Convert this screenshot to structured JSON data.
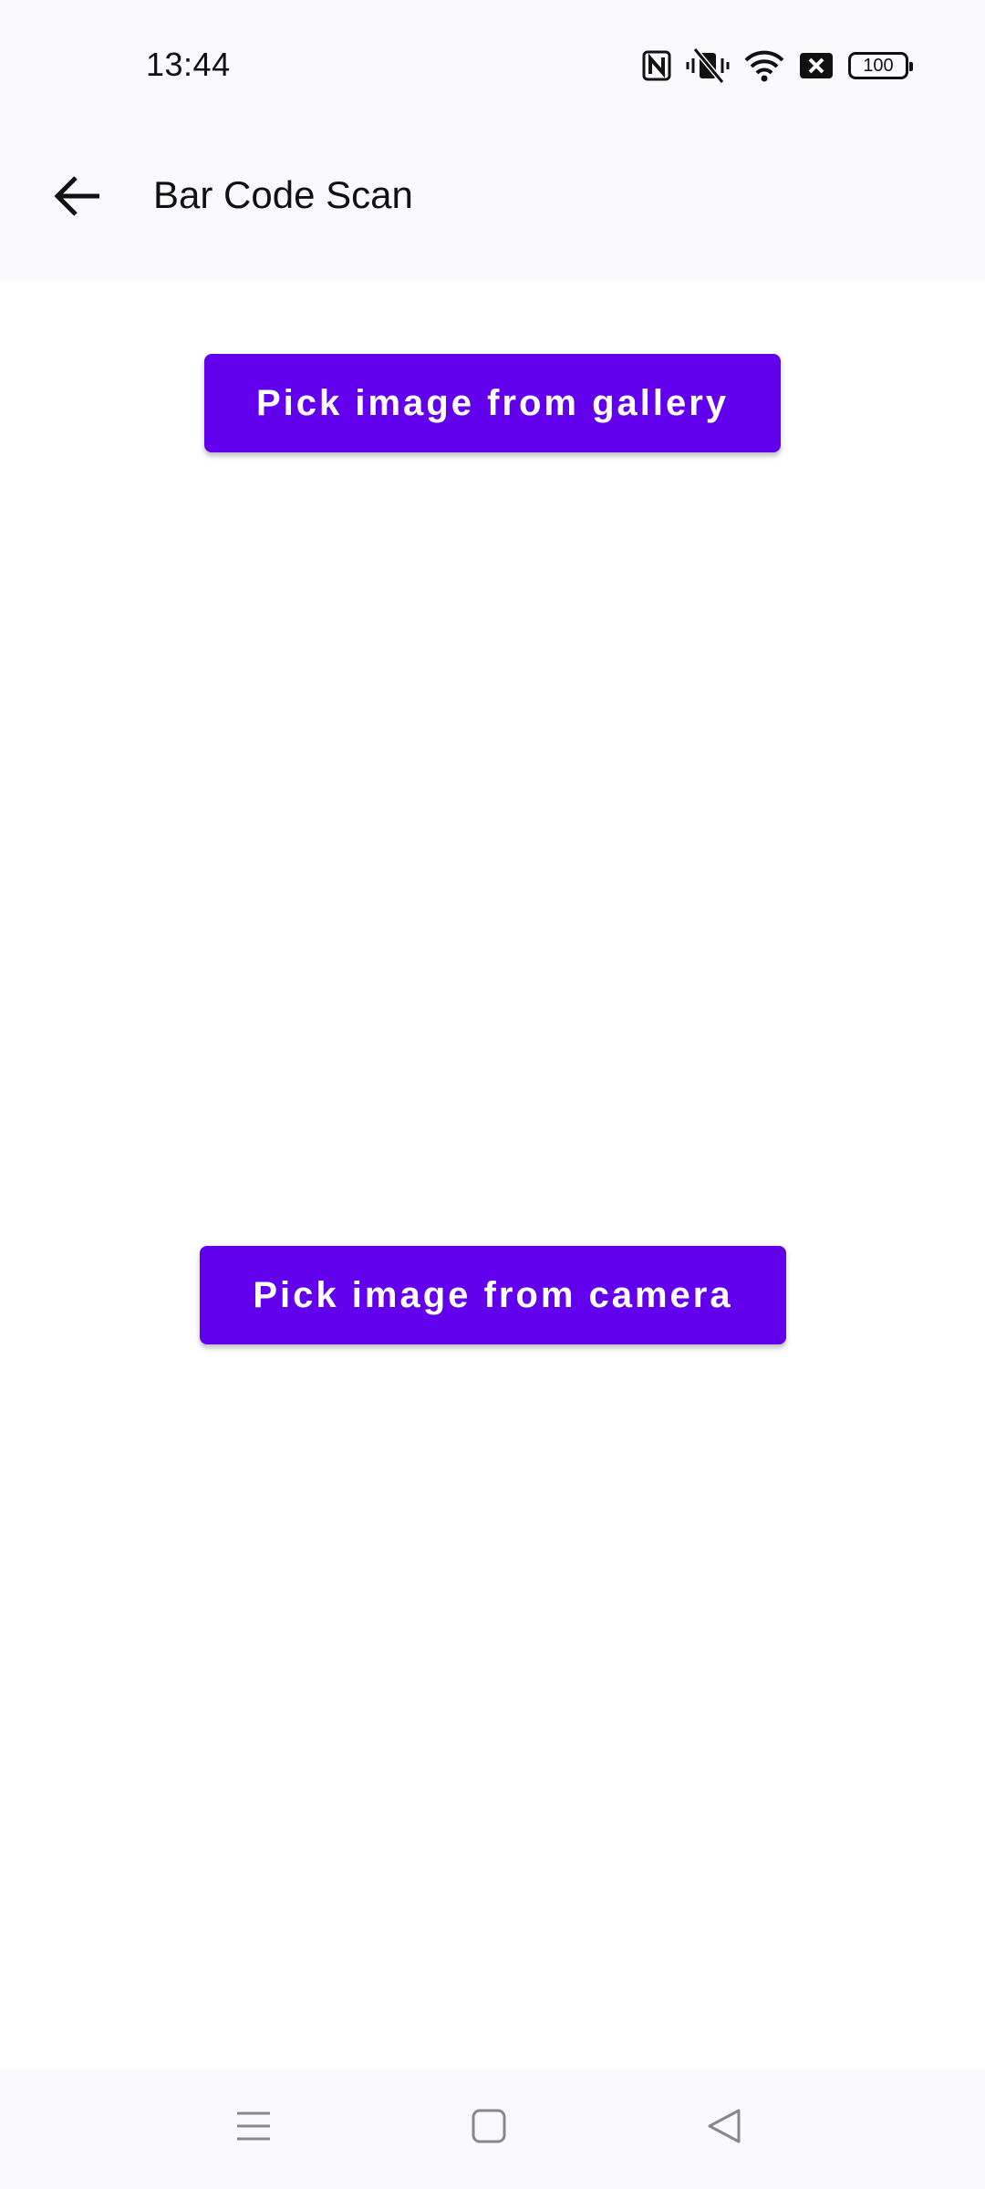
{
  "status_bar": {
    "time": "13:44",
    "icons": [
      "nfc-icon",
      "vibrate-off-icon",
      "wifi-icon",
      "sim-off-icon",
      "battery-icon"
    ],
    "battery_level": "100"
  },
  "app_bar": {
    "title": "Bar Code Scan",
    "back_icon": "arrow-left-icon"
  },
  "actions": {
    "gallery_label": "Pick image from gallery",
    "camera_label": "Pick image from camera"
  },
  "nav_bar": {
    "icons": [
      "menu-icon",
      "home-square-icon",
      "back-triangle-icon"
    ]
  },
  "colors": {
    "accent": "#6200ee",
    "top_background": "#fafafd",
    "content_background": "#ffffff"
  }
}
